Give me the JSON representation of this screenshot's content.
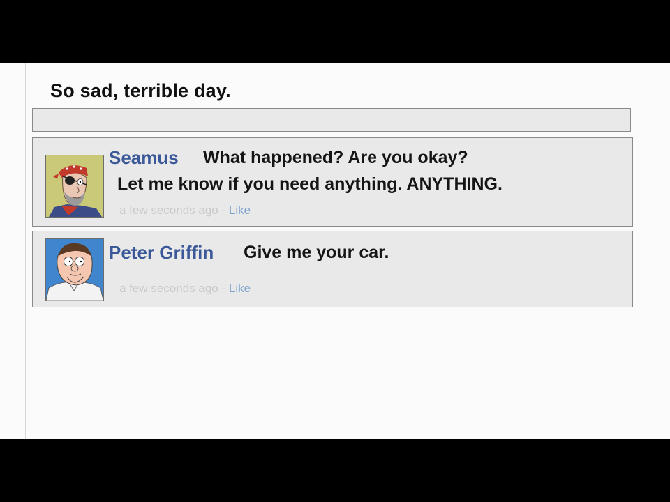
{
  "status": {
    "text": "So sad, terrible day."
  },
  "comments": [
    {
      "author": "Seamus",
      "lines": [
        "What happened?  Are you okay?",
        "Let me know if you need anything.  ANYTHING."
      ],
      "time": "a few seconds ago",
      "separator": " - ",
      "like_label": "Like",
      "avatar_icon": "seamus-avatar-icon"
    },
    {
      "author": "Peter Griffin",
      "lines": [
        "Give me your car."
      ],
      "time": "a few seconds ago",
      "separator": " - ",
      "like_label": "Like",
      "avatar_icon": "peter-griffin-avatar-icon"
    }
  ],
  "colors": {
    "author_link": "#3b5998",
    "like_link": "#7da4cf",
    "timestamp": "#c9c9c9",
    "comment_bg": "#e9e9e9"
  }
}
